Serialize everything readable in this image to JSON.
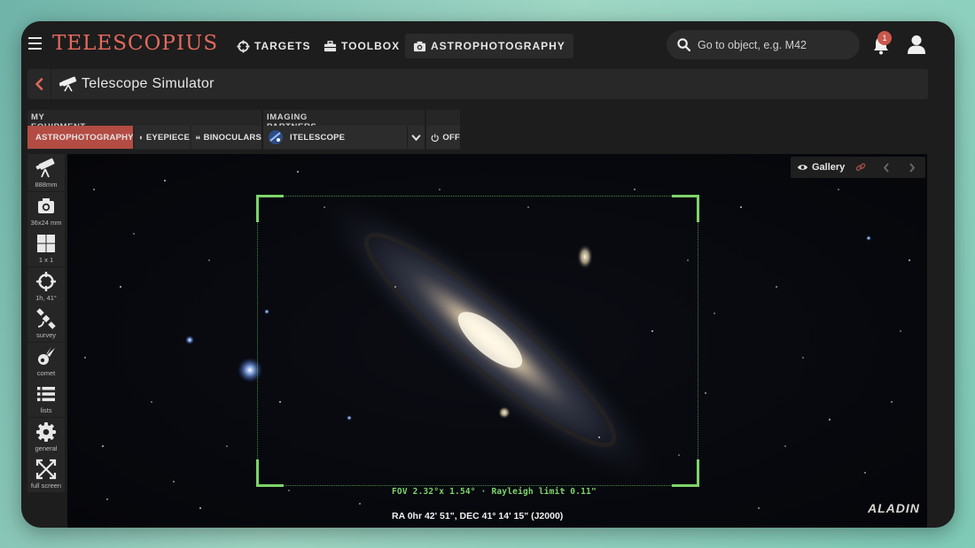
{
  "nav": {
    "logo": "TELESCOPIUS",
    "links": [
      {
        "label": "TARGETS",
        "icon": "crosshair-icon"
      },
      {
        "label": "TOOLBOX",
        "icon": "toolbox-icon"
      },
      {
        "label": "ASTROPHOTOGRAPHY",
        "icon": "camera-icon",
        "active": true
      }
    ],
    "search_placeholder": "Go to object, e.g. M42",
    "notification_count": "1"
  },
  "header": {
    "title": "Telescope Simulator"
  },
  "equipment": {
    "my_equipment_label": "MY EQUIPMENT",
    "imaging_partners_label": "IMAGING PARTNERS",
    "modes": [
      {
        "label": "ASTROPHOTOGRAPHY",
        "icon": "camera-icon",
        "active": true
      },
      {
        "label": "EYEPIECE",
        "icon": "eyepiece-icon"
      },
      {
        "label": "BINOCULARS",
        "icon": "binoculars-icon"
      }
    ],
    "partner_selected": "ITELESCOPE",
    "power_label": "OFF"
  },
  "sidebar": {
    "tools": [
      {
        "label": "888mm",
        "icon": "telescope-icon"
      },
      {
        "label": "36x24 mm",
        "icon": "camera-icon"
      },
      {
        "label": "1 x 1",
        "icon": "grid-icon"
      },
      {
        "label": "1h, 41°",
        "icon": "crosshair-icon"
      },
      {
        "label": "survey",
        "icon": "satellite-icon"
      },
      {
        "label": "comet",
        "icon": "comet-icon"
      },
      {
        "label": "lists",
        "icon": "list-icon"
      },
      {
        "label": "general",
        "icon": "gear-icon"
      },
      {
        "label": "full screen",
        "icon": "fullscreen-icon"
      }
    ]
  },
  "viewer": {
    "gallery_label": "Gallery",
    "fov_text": "FOV 2.32°x 1.54° · Rayleigh limit 0.11\"",
    "coords_text": "RA 0hr 42' 51\", DEC 41° 14' 15\" (J2000)",
    "credit": "ALADIN"
  },
  "colors": {
    "accent": "#b34c43",
    "logo": "#e26a5c",
    "fov_green": "#7ed46a"
  }
}
